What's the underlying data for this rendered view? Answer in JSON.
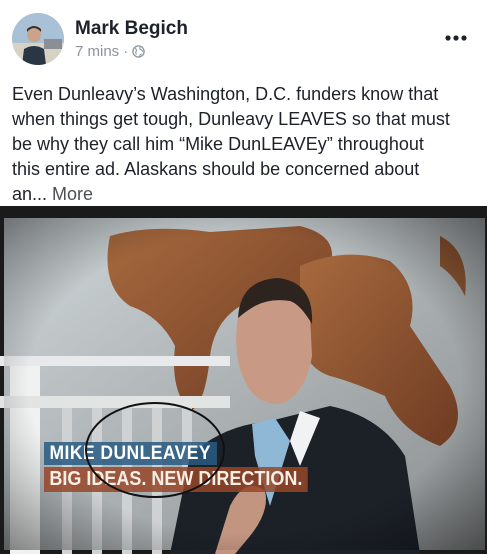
{
  "post": {
    "author": "Mark Begich",
    "timestamp": "7 mins",
    "separator": "·",
    "privacy_icon": "globe-icon",
    "menu_icon": "ellipsis-icon",
    "text": "Even Dunleavy’s Washington, D.C. funders know that\nwhen things get tough, Dunleavy LEAVES so that must\nbe why they call him “Mike DunLEAVEy” throughout\nthis entire ad. Alaskans should be concerned about\nan... ",
    "see_more": "More"
  },
  "video": {
    "name_caption": "MIKE DUNLEAVEY",
    "tagline_caption": "BIG IDEAS. NEW DIRECTION."
  },
  "colors": {
    "link": "#4b4f56",
    "meta": "#8d949e",
    "text": "#1d2129"
  }
}
